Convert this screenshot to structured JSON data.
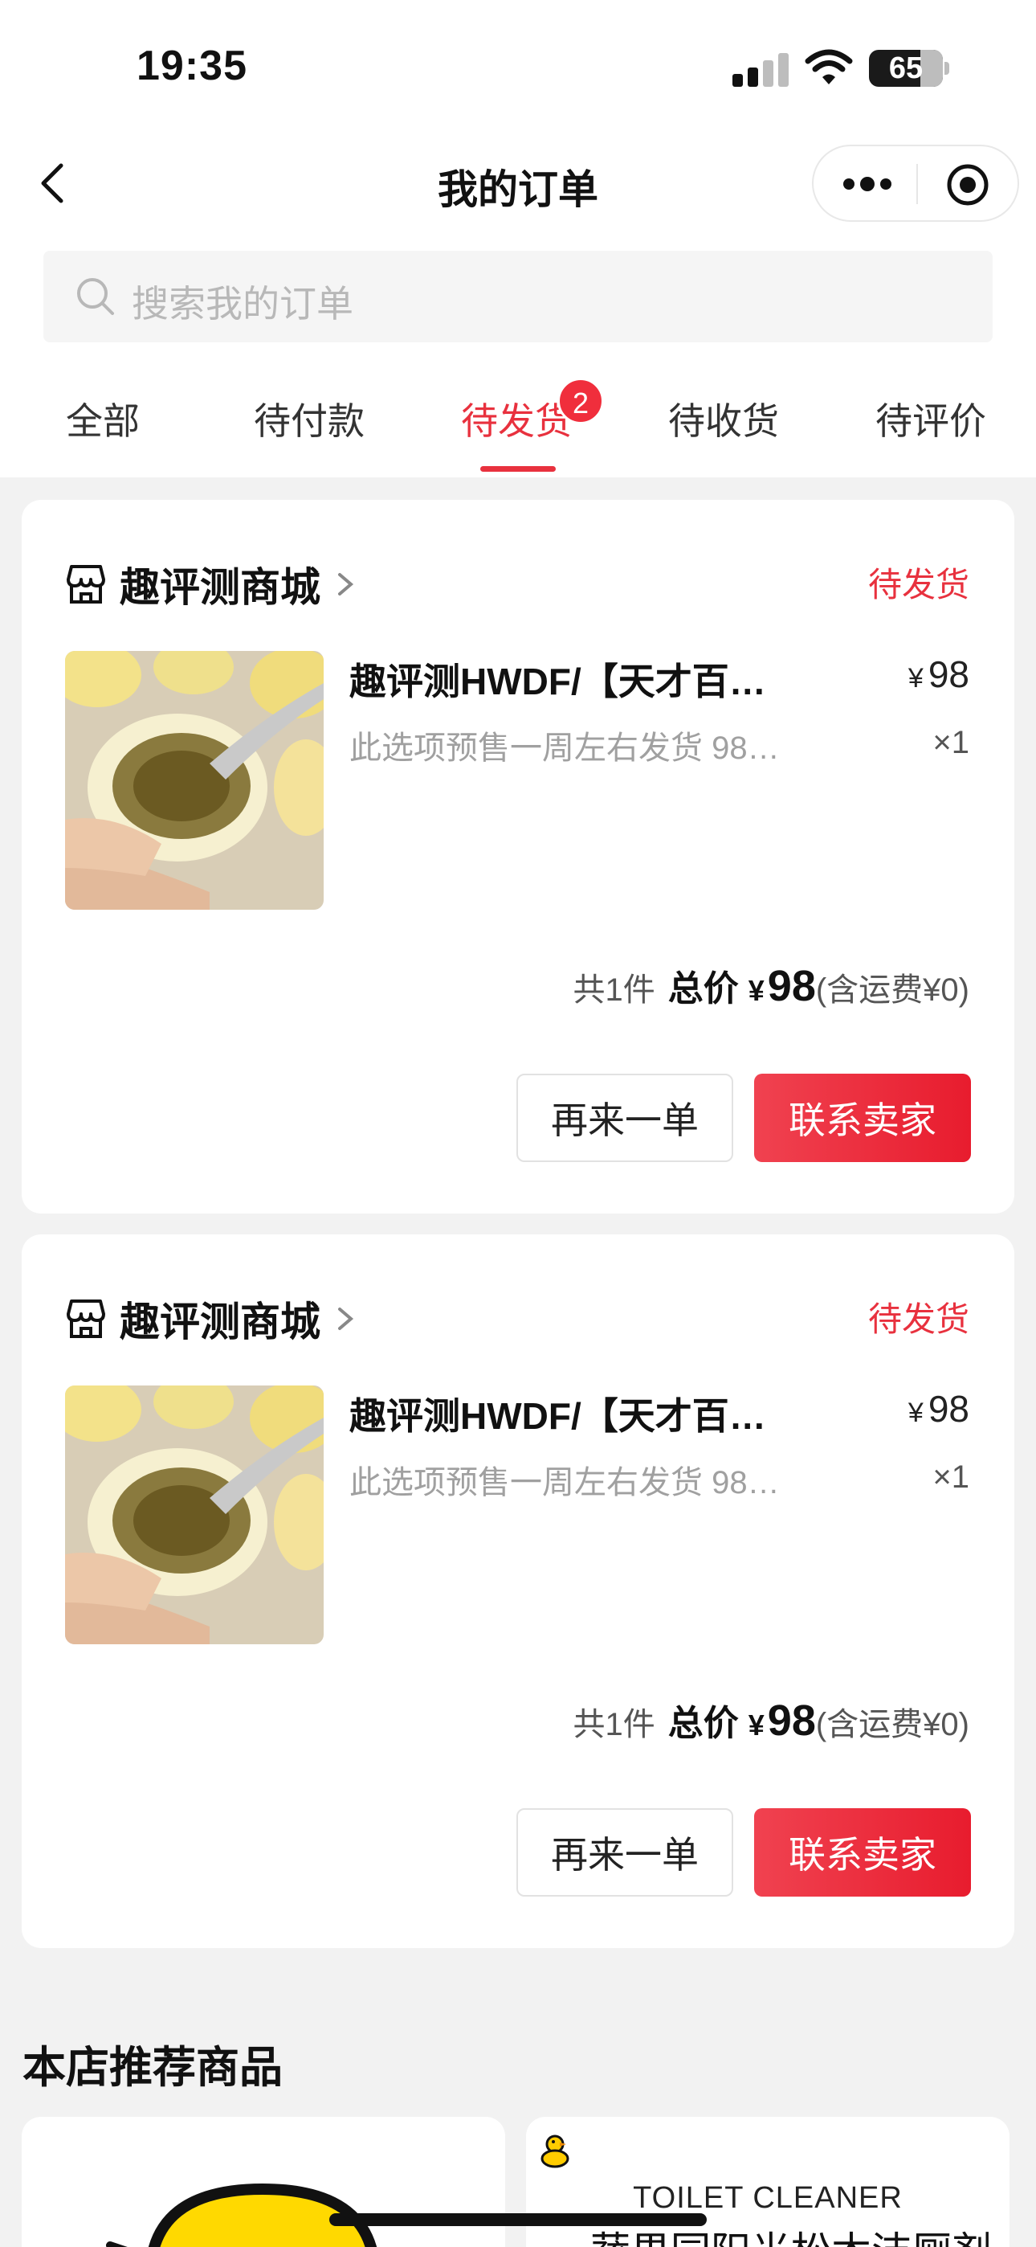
{
  "status_bar": {
    "time": "19:35",
    "battery": "65"
  },
  "nav": {
    "title": "我的订单"
  },
  "search": {
    "placeholder": "搜索我的订单"
  },
  "tabs": [
    {
      "label": "全部",
      "active": false
    },
    {
      "label": "待付款",
      "active": false
    },
    {
      "label": "待发货",
      "active": true,
      "badge": "2"
    },
    {
      "label": "待收货",
      "active": false
    },
    {
      "label": "待评价",
      "active": false
    }
  ],
  "orders": [
    {
      "shop": "趣评测商城",
      "status": "待发货",
      "product_title": "趣评测HWDF/【天才百…",
      "product_desc": "此选项预售一周左右发货 98…",
      "price_symbol": "¥",
      "price": "98",
      "quantity": "×1",
      "count_text": "共1件",
      "total_label": "总价",
      "total_symbol": "¥",
      "total_value": "98",
      "shipping_text": "(含运费¥0)",
      "btn_again": "再来一单",
      "btn_contact": "联系卖家"
    },
    {
      "shop": "趣评测商城",
      "status": "待发货",
      "product_title": "趣评测HWDF/【天才百…",
      "product_desc": "此选项预售一周左右发货 98…",
      "price_symbol": "¥",
      "price": "98",
      "quantity": "×1",
      "count_text": "共1件",
      "total_label": "总价",
      "total_symbol": "¥",
      "total_value": "98",
      "shipping_text": "(含运费¥0)",
      "btn_again": "再来一单",
      "btn_contact": "联系卖家"
    }
  ],
  "recommend": {
    "title": "本店推荐商品",
    "items": [
      {
        "en": "",
        "zh": ""
      },
      {
        "en": "TOILET CLEANER",
        "zh": "蔬果园阳光松木洁厕剂"
      }
    ]
  },
  "colors": {
    "accent": "#e8313e",
    "background": "#f2f2f2",
    "card": "#ffffff"
  }
}
